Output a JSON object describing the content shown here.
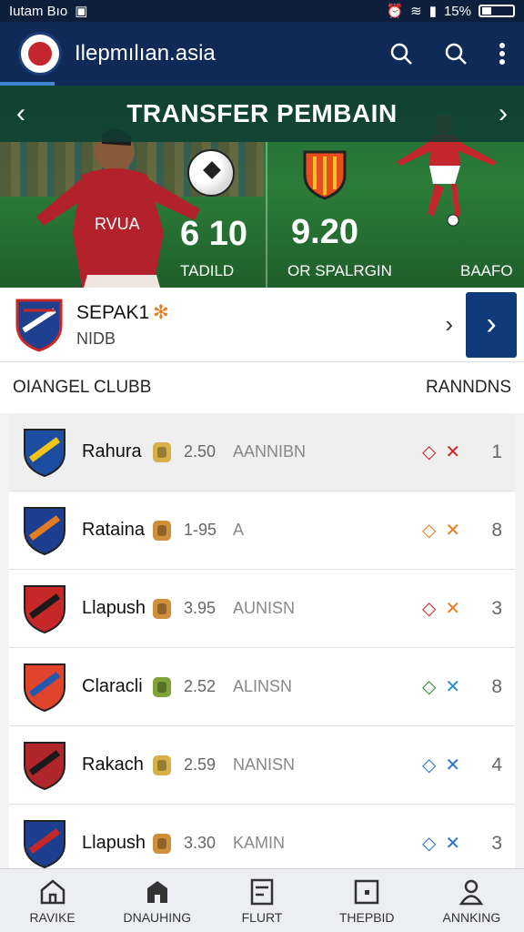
{
  "status_bar": {
    "left_text": "Iutam Bıo",
    "right_text": "15%"
  },
  "app_bar": {
    "title": "Ilepmılıan.asia",
    "icons": [
      "search-icon",
      "search-icon",
      "more-vert-icon"
    ]
  },
  "banner": {
    "title": "TRANSFER PEMBAIN",
    "left_score": "6 10",
    "right_score": "9.20",
    "left_label": "TADILD",
    "middle_label": "OR SPALRGIN",
    "right_label": "BAAFO"
  },
  "featured": {
    "name": "SEPAK1",
    "name_mark": "✻",
    "sub": "NIDB"
  },
  "list_header": {
    "left": "OIANGEL CLUBB",
    "right": "RANNDNS"
  },
  "clubs": [
    {
      "name": "Rahura",
      "rating": "2.50",
      "status": "AANNIBN",
      "rank": "1",
      "mark_colors": [
        "#c62828",
        "#c62828"
      ],
      "badge_color": "#d8b04a",
      "crest_colors": [
        "#1c4da1",
        "#f0c419"
      ]
    },
    {
      "name": "Rataina",
      "rating": "1-95",
      "status": "A",
      "rank": "8",
      "mark_colors": [
        "#e67e22",
        "#e67e22"
      ],
      "badge_color": "#d08f3a",
      "crest_colors": [
        "#1c3f8f",
        "#e27d24"
      ]
    },
    {
      "name": "Llapush",
      "rating": "3.95",
      "status": "AUNISN",
      "rank": "3",
      "mark_colors": [
        "#c62828",
        "#e67e22"
      ],
      "badge_color": "#d08f3a",
      "crest_colors": [
        "#c62828",
        "#1a1a1a"
      ]
    },
    {
      "name": "Claracli",
      "rating": "2.52",
      "status": "ALINSN",
      "rank": "8",
      "mark_colors": [
        "#2e8b3d",
        "#2d8fd0"
      ],
      "badge_color": "#7ea33a",
      "crest_colors": [
        "#e0452c",
        "#2059b0"
      ]
    },
    {
      "name": "Rakach",
      "rating": "2.59",
      "status": "NANISN",
      "rank": "4",
      "mark_colors": [
        "#2d73c9",
        "#2d73c9"
      ],
      "badge_color": "#d7b04a",
      "crest_colors": [
        "#b0262a",
        "#1a1a1a"
      ]
    },
    {
      "name": "Llapush",
      "rating": "3.30",
      "status": "KAMIN",
      "rank": "3",
      "mark_colors": [
        "#2d73c9",
        "#2d73c9"
      ],
      "badge_color": "#d08f3a",
      "crest_colors": [
        "#1c3f8f",
        "#c62828"
      ]
    }
  ],
  "bottom_nav": [
    {
      "label": "RAVIKE",
      "icon": "home-icon"
    },
    {
      "label": "DNAUHING",
      "icon": "store-icon"
    },
    {
      "label": "FLURT",
      "icon": "board-icon"
    },
    {
      "label": "THEPBID",
      "icon": "square-icon"
    },
    {
      "label": "ANNKING",
      "icon": "person-icon"
    }
  ]
}
